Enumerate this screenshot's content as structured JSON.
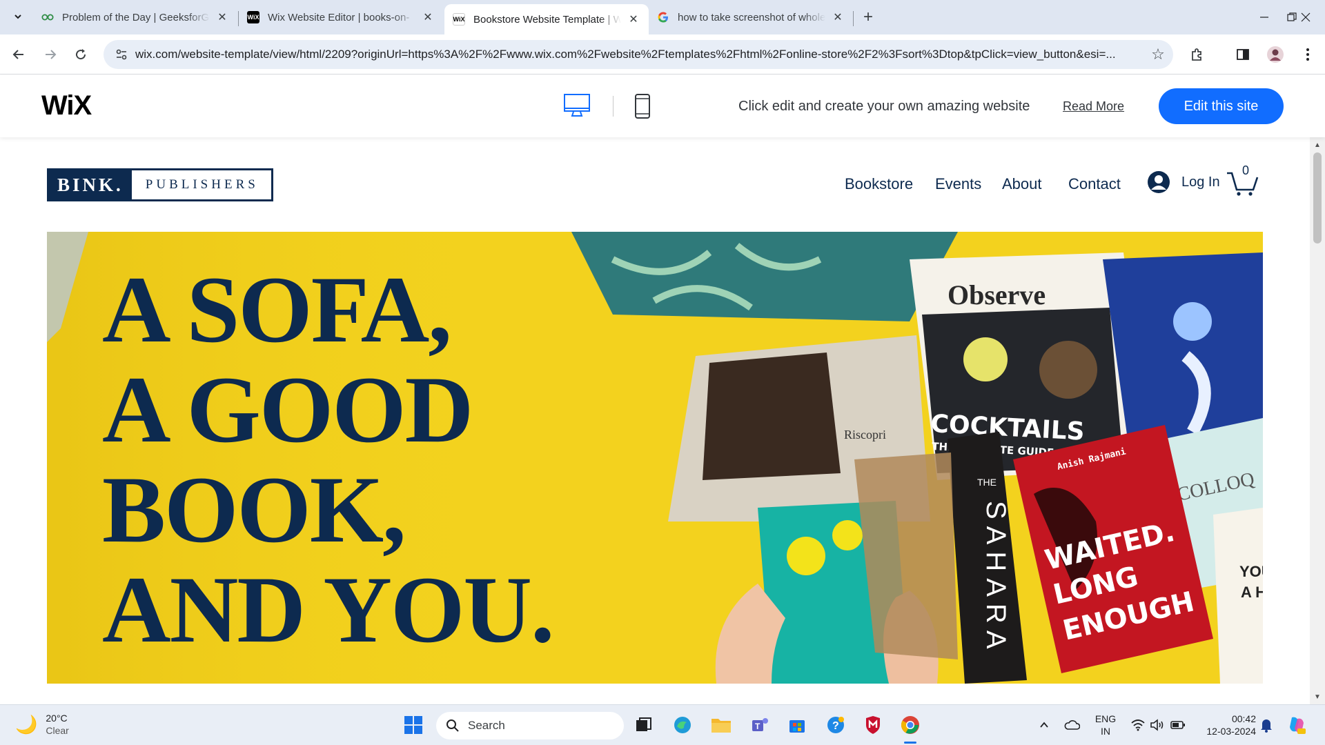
{
  "browser": {
    "tabs": [
      {
        "title": "Problem of the Day | GeeksforGeeks",
        "favicon": "geeksforgeeks-icon",
        "active": false
      },
      {
        "title": "Wix Website Editor | books-on-",
        "favicon": "wix-icon",
        "active": false
      },
      {
        "title": "Bookstore Website Template | Wix",
        "favicon": "wix-icon",
        "active": true
      },
      {
        "title": "how to take screenshot of whole",
        "favicon": "google-icon",
        "active": false
      }
    ],
    "favicon_wix_text": "WiX",
    "url": "wix.com/website-template/view/html/2209?originUrl=https%3A%2F%2Fwww.wix.com%2Fwebsite%2Ftemplates%2Fhtml%2Fonline-store%2F2%3Fsort%3Dtop&tpClick=view_button&esi=..."
  },
  "wix_bar": {
    "logo": "WiX",
    "tagline": "Click edit and create your own amazing website",
    "read_more": "Read More",
    "edit_button": "Edit this site"
  },
  "site": {
    "brand_left": "BINK.",
    "brand_right": "PUBLISHERS",
    "nav": [
      "Bookstore",
      "Events",
      "About",
      "Contact"
    ],
    "login": "Log In",
    "cart_count": "0",
    "hero_lines": [
      "A SOFA,",
      "A GOOD",
      "BOOK,",
      "AND YOU."
    ],
    "hero_image_text": {
      "magazine": "Observe",
      "cocktails": "COCKTAILS",
      "cocktails_sub": "THE ULTIMATE GUIDE",
      "sahara_the": "THE",
      "sahara": "SAHARA",
      "red_author": "Anish Rajmani",
      "red_title_1": "WAITED.",
      "red_title_2": "LONG",
      "red_title_3": "ENOUGH",
      "colloq": "COLLOQ",
      "you": "YOU",
      "ah": "A H"
    }
  },
  "taskbar": {
    "weather_temp": "20°C",
    "weather_cond": "Clear",
    "search": "Search",
    "lang_1": "ENG",
    "lang_2": "IN",
    "time": "00:42",
    "date": "12-03-2024"
  },
  "colors": {
    "navy": "#0d2a4f",
    "hero_yellow": "#f3d21e",
    "wix_blue": "#116dff"
  }
}
